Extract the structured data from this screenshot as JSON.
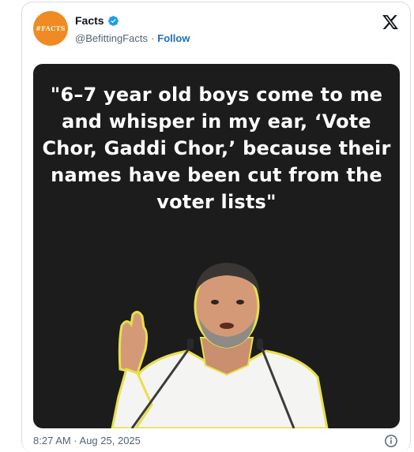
{
  "account": {
    "display_name": "Facts",
    "handle": "@BefittingFacts",
    "separator": "·",
    "follow_label": "Follow",
    "avatar_text": "#FACTS",
    "avatar_color": "#f08a24",
    "verified_icon": "verified-badge-icon",
    "verified_color": "#1d9bf0"
  },
  "post": {
    "quote": "\"6–7 year old boys come to me and whisper in my ear, ‘Vote Chor, Gaddi Chor,’ because their names have been cut from the voter lists\"",
    "image_background": "#1c1c1c",
    "timestamp": "8:27 AM · Aug 25, 2025"
  },
  "icons": {
    "platform_logo": "x-logo-icon",
    "info": "info-icon"
  }
}
